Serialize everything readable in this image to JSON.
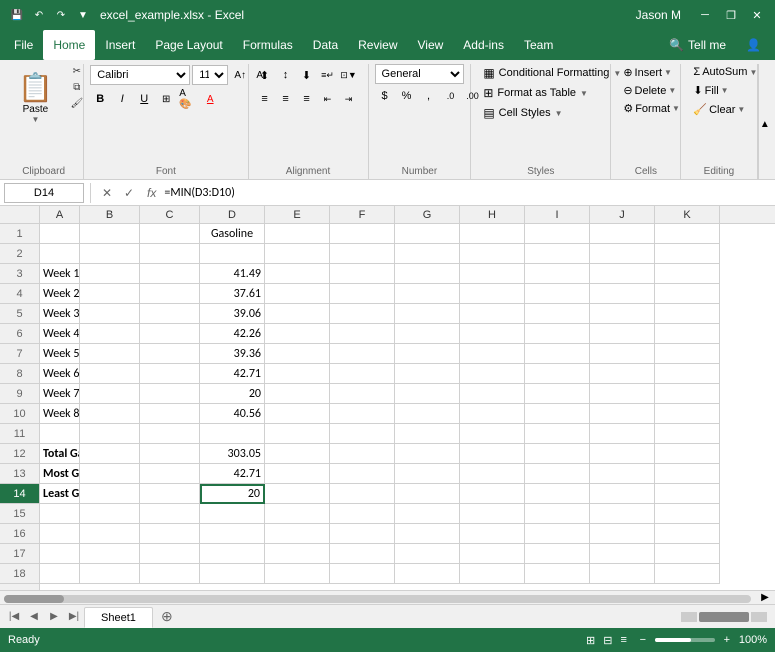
{
  "titlebar": {
    "filename": "excel_example.xlsx - Excel",
    "user": "Jason M",
    "save_icon": "💾",
    "undo_icon": "↶",
    "redo_icon": "↷",
    "minimize": "─",
    "restore": "❐",
    "close": "✕",
    "customize": "▼"
  },
  "menubar": {
    "items": [
      "File",
      "Home",
      "Insert",
      "Page Layout",
      "Formulas",
      "Data",
      "Review",
      "View",
      "Add-ins",
      "Team"
    ]
  },
  "ribbon": {
    "groups": {
      "clipboard": {
        "label": "Clipboard",
        "paste": "Paste"
      },
      "font": {
        "label": "Font",
        "name": "Calibri",
        "size": "11",
        "bold": "B",
        "italic": "I",
        "underline": "U"
      },
      "alignment": {
        "label": "Alignment"
      },
      "number": {
        "label": "Number",
        "format": "General"
      },
      "styles": {
        "label": "Styles",
        "conditional": "Conditional Formatting",
        "format_table": "Format as Table",
        "cell_styles": "Cell Styles"
      },
      "cells": {
        "label": "Cells",
        "insert": "Insert",
        "delete": "Delete",
        "format": "Format"
      },
      "editing": {
        "label": "Editing"
      }
    }
  },
  "formulabar": {
    "cell_ref": "D14",
    "formula": "=MIN(D3:D10)",
    "fx": "fx"
  },
  "columns": [
    "A",
    "B",
    "C",
    "D",
    "E",
    "F",
    "G",
    "H",
    "I",
    "J",
    "K"
  ],
  "rows": [
    {
      "num": 1,
      "cells": {
        "A": "",
        "B": "",
        "C": "",
        "D": "Gasoline",
        "E": "",
        "F": "",
        "G": "",
        "H": "",
        "I": "",
        "J": "",
        "K": ""
      }
    },
    {
      "num": 2,
      "cells": {
        "A": "",
        "B": "",
        "C": "",
        "D": "",
        "E": "",
        "F": "",
        "G": "",
        "H": "",
        "I": "",
        "J": "",
        "K": ""
      }
    },
    {
      "num": 3,
      "cells": {
        "A": "Week 1",
        "B": "",
        "C": "",
        "D": "41.49",
        "E": "",
        "F": "",
        "G": "",
        "H": "",
        "I": "",
        "J": "",
        "K": ""
      }
    },
    {
      "num": 4,
      "cells": {
        "A": "Week 2",
        "B": "",
        "C": "",
        "D": "37.61",
        "E": "",
        "F": "",
        "G": "",
        "H": "",
        "I": "",
        "J": "",
        "K": ""
      }
    },
    {
      "num": 5,
      "cells": {
        "A": "Week 3",
        "B": "",
        "C": "",
        "D": "39.06",
        "E": "",
        "F": "",
        "G": "",
        "H": "",
        "I": "",
        "J": "",
        "K": ""
      }
    },
    {
      "num": 6,
      "cells": {
        "A": "Week 4",
        "B": "",
        "C": "",
        "D": "42.26",
        "E": "",
        "F": "",
        "G": "",
        "H": "",
        "I": "",
        "J": "",
        "K": ""
      }
    },
    {
      "num": 7,
      "cells": {
        "A": "Week 5",
        "B": "",
        "C": "",
        "D": "39.36",
        "E": "",
        "F": "",
        "G": "",
        "H": "",
        "I": "",
        "J": "",
        "K": ""
      }
    },
    {
      "num": 8,
      "cells": {
        "A": "Week 6",
        "B": "",
        "C": "",
        "D": "42.71",
        "E": "",
        "F": "",
        "G": "",
        "H": "",
        "I": "",
        "J": "",
        "K": ""
      }
    },
    {
      "num": 9,
      "cells": {
        "A": "Week 7",
        "B": "",
        "C": "",
        "D": "20",
        "E": "",
        "F": "",
        "G": "",
        "H": "",
        "I": "",
        "J": "",
        "K": ""
      }
    },
    {
      "num": 10,
      "cells": {
        "A": "Week 8",
        "B": "",
        "C": "",
        "D": "40.56",
        "E": "",
        "F": "",
        "G": "",
        "H": "",
        "I": "",
        "J": "",
        "K": ""
      }
    },
    {
      "num": 11,
      "cells": {
        "A": "",
        "B": "",
        "C": "",
        "D": "",
        "E": "",
        "F": "",
        "G": "",
        "H": "",
        "I": "",
        "J": "",
        "K": ""
      }
    },
    {
      "num": 12,
      "cells": {
        "A": "Total Gas Paid",
        "B": "",
        "C": "",
        "D": "303.05",
        "E": "",
        "F": "",
        "G": "",
        "H": "",
        "I": "",
        "J": "",
        "K": ""
      }
    },
    {
      "num": 13,
      "cells": {
        "A": "Most Gas Paid Per Week",
        "B": "",
        "C": "",
        "D": "42.71",
        "E": "",
        "F": "",
        "G": "",
        "H": "",
        "I": "",
        "J": "",
        "K": ""
      }
    },
    {
      "num": 14,
      "cells": {
        "A": "Least Gas Paid Per Week",
        "B": "",
        "C": "",
        "D": "20",
        "E": "",
        "F": "",
        "G": "",
        "H": "",
        "I": "",
        "J": "",
        "K": ""
      }
    },
    {
      "num": 15,
      "cells": {
        "A": "",
        "B": "",
        "C": "",
        "D": "",
        "E": "",
        "F": "",
        "G": "",
        "H": "",
        "I": "",
        "J": "",
        "K": ""
      }
    },
    {
      "num": 16,
      "cells": {
        "A": "",
        "B": "",
        "C": "",
        "D": "",
        "E": "",
        "F": "",
        "G": "",
        "H": "",
        "I": "",
        "J": "",
        "K": ""
      }
    },
    {
      "num": 17,
      "cells": {
        "A": "",
        "B": "",
        "C": "",
        "D": "",
        "E": "",
        "F": "",
        "G": "",
        "H": "",
        "I": "",
        "J": "",
        "K": ""
      }
    },
    {
      "num": 18,
      "cells": {
        "A": "",
        "B": "",
        "C": "",
        "D": "",
        "E": "",
        "F": "",
        "G": "",
        "H": "",
        "I": "",
        "J": "",
        "K": ""
      }
    }
  ],
  "numeric_cells": {
    "D3": true,
    "D4": true,
    "D5": true,
    "D6": true,
    "D7": true,
    "D8": true,
    "D9": true,
    "D10": true,
    "D12": true,
    "D13": true,
    "D14": true
  },
  "center_cells": {
    "D1": true
  },
  "bold_cells": {
    "A12": true,
    "A13": true,
    "A14": true
  },
  "active_cell": "D14",
  "sheets": [
    "Sheet1"
  ],
  "status": {
    "ready": "Ready",
    "zoom": "100%"
  }
}
